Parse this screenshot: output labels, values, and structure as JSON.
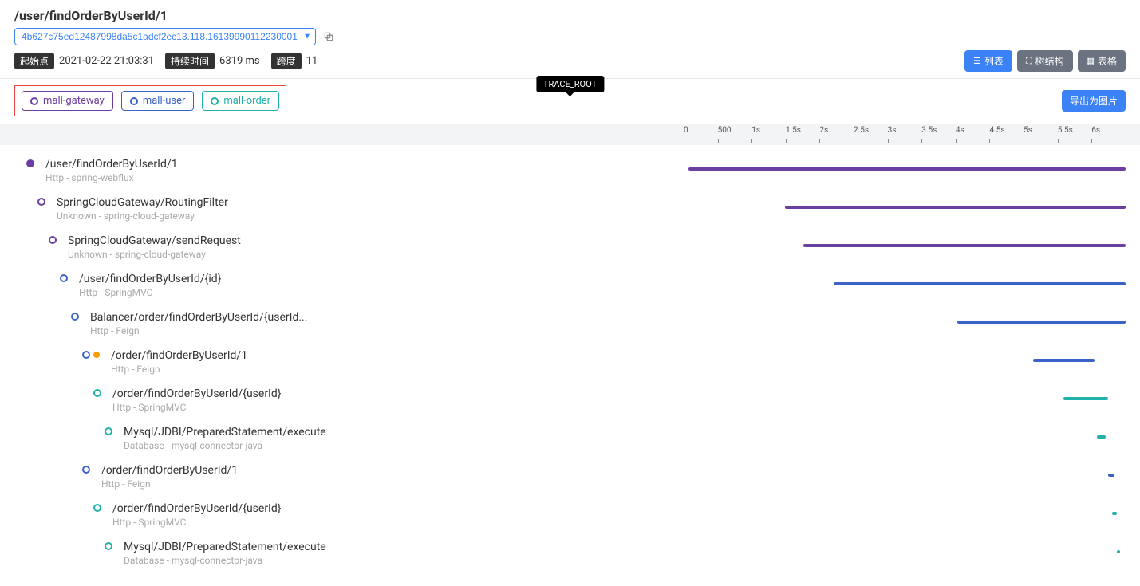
{
  "title": "/user/findOrderByUserId/1",
  "trace_id": "4b627c75ed12487998da5c1adcf2ec13.118.16139990112230001",
  "meta": {
    "start_label": "起始点",
    "start_value": "2021-02-22 21:03:31",
    "duration_label": "持续时间",
    "duration_value": "6319 ms",
    "span_label": "跨度",
    "span_value": "11"
  },
  "view_buttons": {
    "list": "列表",
    "tree": "树结构",
    "table": "表格"
  },
  "trace_root": "TRACE_ROOT",
  "export_btn": "导出为图片",
  "services": [
    {
      "name": "mall-gateway",
      "cls": "chip-purple"
    },
    {
      "name": "mall-user",
      "cls": "chip-blue"
    },
    {
      "name": "mall-order",
      "cls": "chip-teal"
    }
  ],
  "ticks": [
    "0",
    "500",
    "1s",
    "1.5s",
    "2s",
    "2.5s",
    "3s",
    "3.5s",
    "4s",
    "4.5s",
    "5s",
    "5.5s",
    "6s"
  ],
  "spans": [
    {
      "name": "/user/findOrderByUserId/1",
      "sub": "Http - spring-webflux",
      "depth": 0,
      "dot": "dot-purple-fill",
      "bar": {
        "cls": "bar-purple",
        "l": 1,
        "w": 99
      }
    },
    {
      "name": "SpringCloudGateway/RoutingFilter",
      "sub": "Unknown - spring-cloud-gateway",
      "depth": 1,
      "dot": "dot-purple",
      "bar": {
        "cls": "bar-purple",
        "l": 23,
        "w": 77
      }
    },
    {
      "name": "SpringCloudGateway/sendRequest",
      "sub": "Unknown - spring-cloud-gateway",
      "depth": 2,
      "dot": "dot-purple",
      "bar": {
        "cls": "bar-purple",
        "l": 27,
        "w": 73
      }
    },
    {
      "name": "/user/findOrderByUserId/{id}",
      "sub": "Http - SpringMVC",
      "depth": 3,
      "dot": "dot-blue",
      "bar": {
        "cls": "bar-blue",
        "l": 34,
        "w": 66
      }
    },
    {
      "name": "Balancer/order/findOrderByUserId/{userId...",
      "sub": "Http - Feign",
      "depth": 4,
      "dot": "dot-blue",
      "bar": {
        "cls": "bar-blue",
        "l": 62,
        "w": 38
      }
    },
    {
      "name": "/order/findOrderByUserId/1",
      "sub": "Http - Feign",
      "depth": 5,
      "dot": "cluster",
      "bar": {
        "cls": "bar-blue",
        "l": 79,
        "w": 14
      }
    },
    {
      "name": "/order/findOrderByUserId/{userId}",
      "sub": "Http - SpringMVC",
      "depth": 6,
      "dot": "dot-teal",
      "bar": {
        "cls": "bar-teal",
        "l": 86,
        "w": 10
      }
    },
    {
      "name": "Mysql/JDBI/PreparedStatement/execute",
      "sub": "Database - mysql-connector-java",
      "depth": 7,
      "dot": "dot-teal",
      "bar": {
        "cls": "bar-teal",
        "l": 93.5,
        "w": 2
      }
    },
    {
      "name": "/order/findOrderByUserId/1",
      "sub": "Http - Feign",
      "depth": 5,
      "dot": "dot-blue",
      "bar": {
        "cls": "bar-blue",
        "l": 96,
        "w": 1.5
      }
    },
    {
      "name": "/order/findOrderByUserId/{userId}",
      "sub": "Http - SpringMVC",
      "depth": 6,
      "dot": "dot-teal",
      "bar": {
        "cls": "bar-teal",
        "l": 97,
        "w": 1
      }
    },
    {
      "name": "Mysql/JDBI/PreparedStatement/execute",
      "sub": "Database - mysql-connector-java",
      "depth": 7,
      "dot": "dot-teal",
      "bar": {
        "cls": "bar-teal",
        "l": 98,
        "w": 0.7
      }
    }
  ]
}
